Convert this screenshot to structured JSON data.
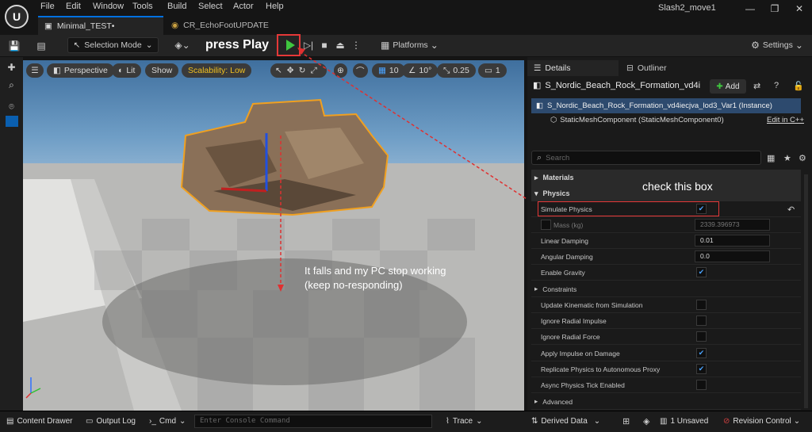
{
  "menu": [
    "File",
    "Edit",
    "Window",
    "Tools",
    "Build",
    "Select",
    "Actor",
    "Help"
  ],
  "tabs": [
    {
      "label": "Minimal_TEST•"
    },
    {
      "label": "CR_EchoFootUPDATE"
    }
  ],
  "window_title": "Slash2_move1",
  "toolbar": {
    "selection_mode": "Selection Mode",
    "platforms": "Platforms",
    "settings": "Settings"
  },
  "annotations": {
    "press_play": "press Play",
    "check_box": "check this box",
    "falls": "It falls and my PC stop working",
    "falls2": "(keep no-responding)"
  },
  "viewport": {
    "perspective": "Perspective",
    "lit": "Lit",
    "show": "Show",
    "scalability": "Scalability: Low",
    "grid": "10",
    "angle": "10°",
    "scale": "0.25",
    "cams": "1"
  },
  "panel": {
    "details_tab": "Details",
    "outliner_tab": "Outliner",
    "actor_name": "S_Nordic_Beach_Rock_Formation_vd4i",
    "add": "Add",
    "instance": "S_Nordic_Beach_Rock_Formation_vd4iecjva_lod3_Var1 (Instance)",
    "component": "StaticMeshComponent (StaticMeshComponent0)",
    "edit_cpp": "Edit in C++",
    "search_placeholder": "Search",
    "sections": {
      "materials": "Materials",
      "physics": "Physics",
      "constraints": "Constraints",
      "advanced": "Advanced"
    },
    "simulate_physics": "Simulate Physics",
    "mass_label": "Mass (kg)",
    "mass_value": "2339.396973",
    "linear_damping": "Linear Damping",
    "linear_damping_value": "0.01",
    "angular_damping": "Angular Damping",
    "angular_damping_value": "0.0",
    "enable_gravity": "Enable Gravity",
    "props": [
      "Update Kinematic from Simulation",
      "Ignore Radial Impulse",
      "Ignore Radial Force",
      "Apply Impulse on Damage",
      "Replicate Physics to Autonomous Proxy",
      "Async Physics Tick Enabled"
    ]
  },
  "status": {
    "content_drawer": "Content Drawer",
    "output_log": "Output Log",
    "cmd": "Cmd",
    "console_placeholder": "Enter Console Command",
    "trace": "Trace",
    "derived_data": "Derived Data",
    "unsaved": "1 Unsaved",
    "revision": "Revision Control"
  }
}
